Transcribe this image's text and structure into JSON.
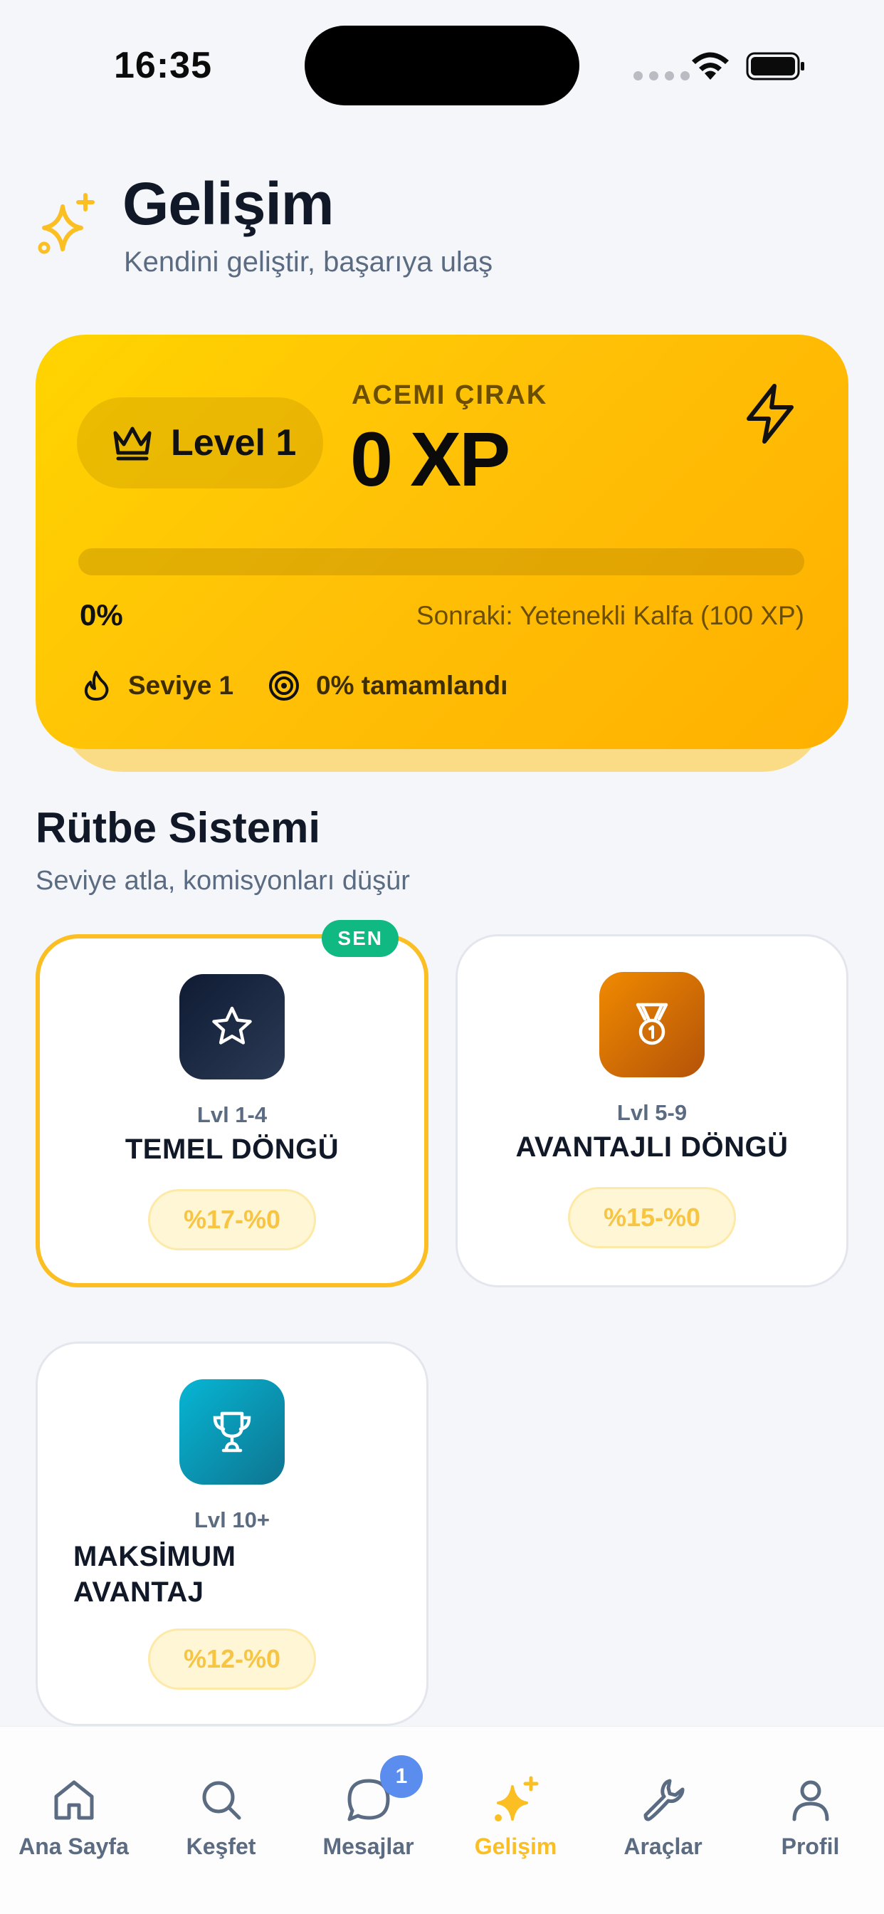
{
  "status_bar": {
    "time": "16:35"
  },
  "header": {
    "title": "Gelişim",
    "subtitle": "Kendini geliştir, başarıya ulaş"
  },
  "xp_card": {
    "level_label": "Level 1",
    "rank_name": "ACEMI ÇIRAK",
    "xp": "0 XP",
    "progress_fraction": 0,
    "progress_label": "0%",
    "next_rank": "Sonraki: Yetenekli Kalfa (100 XP)",
    "stat_level": "Seviye 1",
    "stat_completed": "0% tamamlandı"
  },
  "rank_section": {
    "title": "Rütbe Sistemi",
    "subtitle": "Seviye atla, komisyonları düşür",
    "current_badge": "SEN",
    "ranks": [
      {
        "level": "Lvl 1-4",
        "name": "TEMEL DÖNGÜ",
        "rate": "%17-%0",
        "icon": "star-icon",
        "color_from": "#0f1b33",
        "color_to": "#2b3a55"
      },
      {
        "level": "Lvl 5-9",
        "name": "AVANTAJLI DÖNGÜ",
        "rate": "%15-%0",
        "icon": "medal-icon",
        "color_from": "#f08a00",
        "color_to": "#b45309"
      },
      {
        "level": "Lvl 10+",
        "name": "MAKSİMUM AVANTAJ",
        "name_line1": "MAKSİMUM",
        "name_line2": "AVANTAJ",
        "rate": "%12-%0",
        "icon": "trophy-icon",
        "color_from": "#06b6d4",
        "color_to": "#0e7490"
      }
    ]
  },
  "tab_bar": {
    "tabs": [
      {
        "label": "Ana Sayfa",
        "icon": "home-icon"
      },
      {
        "label": "Keşfet",
        "icon": "search-icon"
      },
      {
        "label": "Mesajlar",
        "icon": "chat-icon",
        "badge": "1"
      },
      {
        "label": "Gelişim",
        "icon": "sparkles-icon",
        "active": true
      },
      {
        "label": "Araçlar",
        "icon": "wrench-icon"
      },
      {
        "label": "Profil",
        "icon": "user-icon"
      }
    ]
  },
  "colors": {
    "accent": "#fbbf24",
    "badge_green": "#10b981",
    "text_muted": "#5b6b82"
  }
}
